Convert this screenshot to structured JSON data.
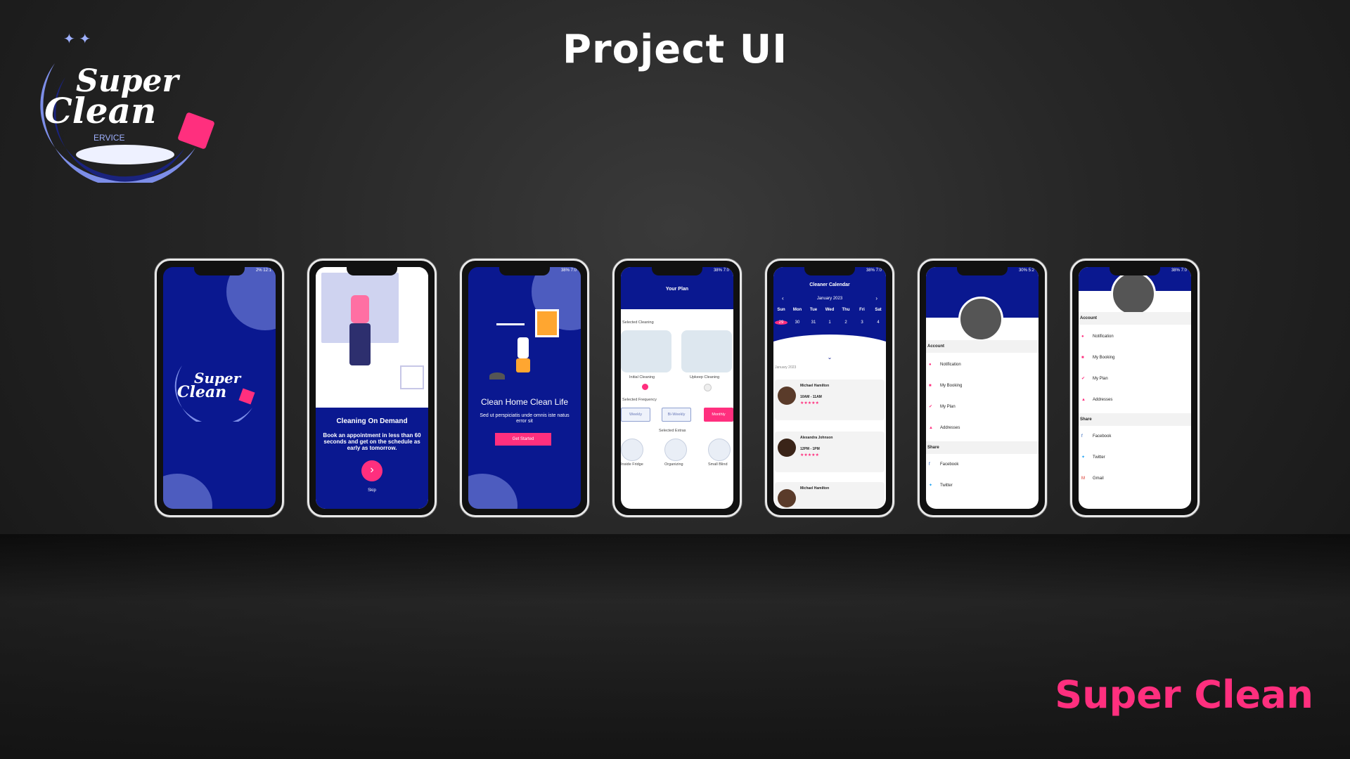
{
  "page": {
    "title": "Project UI",
    "brand": "Super Clean",
    "logo_text": "Super Clean",
    "logo_subtext": "ERVICE"
  },
  "colors": {
    "navy": "#0a1890",
    "pink": "#ff2f7e",
    "blob": "#4d5cbf"
  },
  "screens": {
    "splash": {
      "status": "2% 12:1"
    },
    "onboard1": {
      "status": "",
      "title": "Cleaning On Demand",
      "text": "Book an appointment in less than 60 seconds and get on the schedule as early as tomorrow.",
      "next_icon": "›",
      "skip": "Skip"
    },
    "onboard2": {
      "status": "38% 7:0",
      "title": "Clean Home Clean Life",
      "subtitle": "Sed ut perspiciatis unde omnis iste natus error sit",
      "button": "Get Started"
    },
    "plan": {
      "status": "38% 7:0",
      "title": "Your Plan",
      "selected_cleaning": "Selected Cleaning",
      "options": [
        "Initial Cleaning",
        "Upkeep Cleaning"
      ],
      "selected_frequency": "Selected Frequency",
      "frequency": [
        "Weekly",
        "Bi-Weekly",
        "Monthly"
      ],
      "selected_extras": "Selected Extras",
      "extras": [
        "Inside Fridge",
        "Organizing",
        "Small Blind"
      ]
    },
    "calendar": {
      "status": "38% 7:0",
      "title": "Cleaner Calendar",
      "month": "January 2023",
      "days": [
        "Sun",
        "Mon",
        "Tue",
        "Wed",
        "Thu",
        "Fri",
        "Sat"
      ],
      "dates": [
        "29",
        "30",
        "31",
        "1",
        "2",
        "3",
        "4"
      ],
      "list_label": "January 2023",
      "cleaners": [
        {
          "name": "Michael Hamilton",
          "time": "10AM - 11AM",
          "stars": "★★★★★"
        },
        {
          "name": "Alexandra Johnson",
          "time": "12PM - 1PM",
          "stars": "★★★★★"
        },
        {
          "name": "Michael Hamilton",
          "time": "",
          "stars": ""
        }
      ]
    },
    "menu1": {
      "status": "30% 5:2",
      "account": "Account",
      "items": [
        "Notification",
        "My Booking",
        "My Plan",
        "Addresses"
      ],
      "share": "Share",
      "share_items": [
        "Facebook",
        "Twitter"
      ]
    },
    "menu2": {
      "status": "38% 7:0",
      "account": "Account",
      "items": [
        "Notification",
        "My Booking",
        "My Plan",
        "Addresses"
      ],
      "share": "Share",
      "share_items": [
        "Facebook",
        "Twitter",
        "Gmail"
      ]
    }
  }
}
